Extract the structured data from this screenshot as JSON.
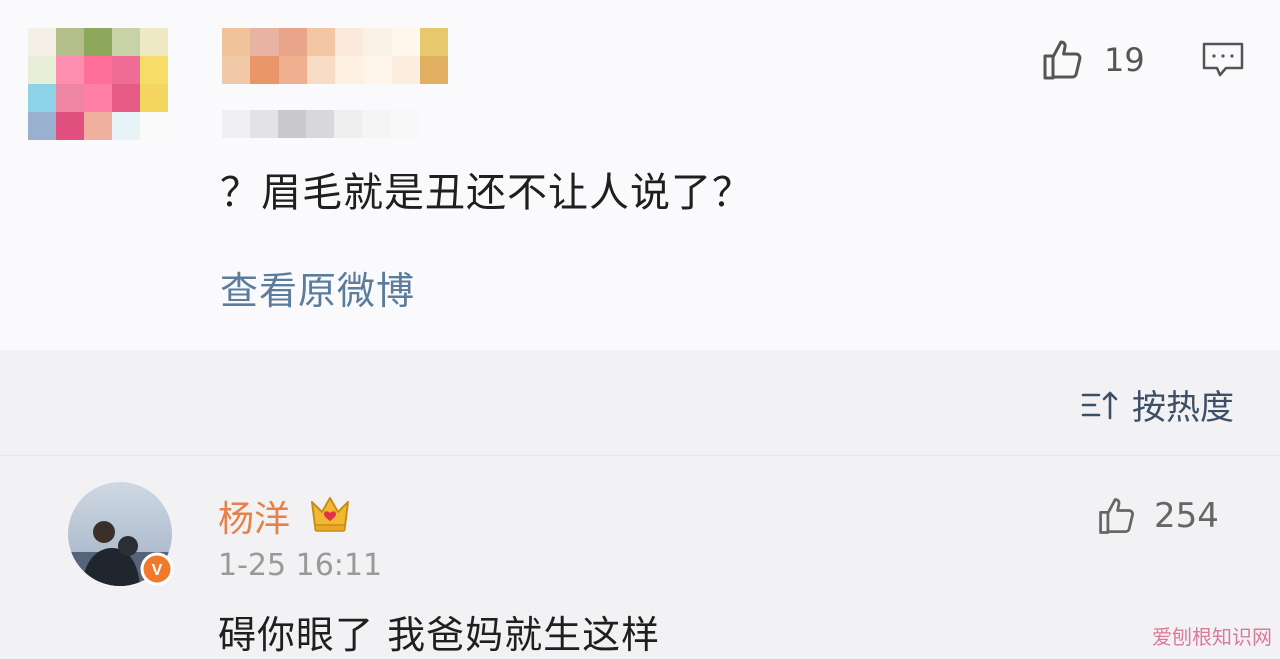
{
  "post": {
    "like_count": "19",
    "text": "？眉毛就是丑还不让人说了？",
    "view_original_label": "查看原微博"
  },
  "mosaics": {
    "avatar": [
      "#f4efe7",
      "#b3be8a",
      "#8ea85b",
      "#c7d2a7",
      "#efe9c6",
      "#e8edd8",
      "#ff8fb0",
      "#ff6f9a",
      "#ee6c95",
      "#f6dd68",
      "#8fd3e8",
      "#ef86a1",
      "#ff7fa6",
      "#e55b86",
      "#f4d660",
      "#9ab0d0",
      "#e04f7d",
      "#f0b0a0",
      "#e8f3f8",
      "#fafafa"
    ],
    "name": [
      "#f0c39a",
      "#e8b3a0",
      "#e8a58a",
      "#f2c6a2",
      "#fbe9dc",
      "#fbf2e7",
      "#fff7ec",
      "#e8c86c",
      "#f2c9a8",
      "#e8966a",
      "#f0b090",
      "#f9dcc6",
      "#fff1e2",
      "#fff4ea",
      "#fbeede",
      "#e0b060"
    ],
    "meta": [
      "#f0f0f2",
      "#e3e3e6",
      "#c9c9cd",
      "#d8d8dc",
      "#eeeeef",
      "#f5f5f6",
      "#f8f8f9"
    ]
  },
  "sort": {
    "label": "按热度"
  },
  "reply": {
    "username": "杨洋",
    "timestamp": "1-25 16:11",
    "text": "碍你眼了 我爸妈就生这样",
    "like_count": "254",
    "verified_badge": "V"
  },
  "watermark": "爱刨根知识网",
  "icons": {
    "like": "thumbs-up-icon",
    "comment": "comment-bubble-icon",
    "sort": "sort-icon",
    "crown": "crown-icon",
    "verified": "verified-badge-icon"
  },
  "colors": {
    "username": "#e6814a",
    "link": "#5b7c9c",
    "badge": "#f07a2a"
  }
}
